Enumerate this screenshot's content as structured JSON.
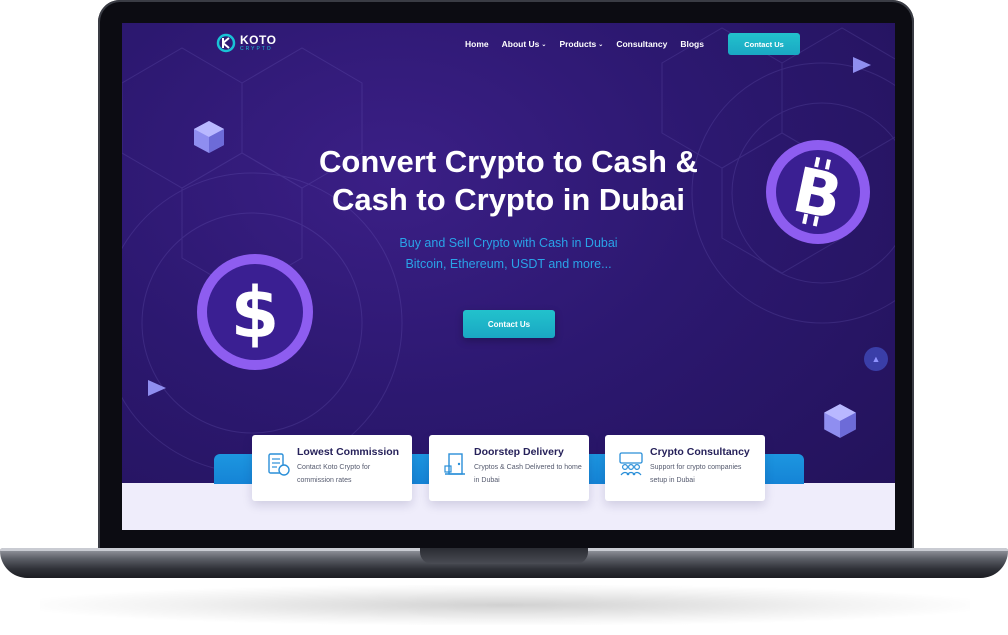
{
  "header": {
    "logo": {
      "name": "KOTO",
      "sub": "CRYPTO"
    },
    "nav": [
      {
        "label": "Home",
        "dropdown": false
      },
      {
        "label": "About Us",
        "dropdown": true
      },
      {
        "label": "Products",
        "dropdown": true
      },
      {
        "label": "Consultancy",
        "dropdown": false
      },
      {
        "label": "Blogs",
        "dropdown": false
      }
    ],
    "contact_button": "Contact Us"
  },
  "hero": {
    "title_line1": "Convert Crypto to Cash &",
    "title_line2": "Cash to Crypto in Dubai",
    "subtitle_line1": "Buy and Sell Crypto with Cash in Dubai",
    "subtitle_line2": "Bitcoin, Ethereum, USDT and more...",
    "contact_button": "Contact Us"
  },
  "features": [
    {
      "title": "Lowest Commission",
      "desc": "Contact Koto Crypto for commission rates",
      "icon": "document-icon"
    },
    {
      "title": "Doorstep Delivery",
      "desc": "Cryptos & Cash Delivered to home in Dubai",
      "icon": "door-icon"
    },
    {
      "title": "Crypto Consultancy",
      "desc": "Support for crypto companies setup in Dubai",
      "icon": "team-icon"
    }
  ],
  "colors": {
    "hero_bg": "#2c1870",
    "accent_teal": "#1aa7c4",
    "accent_blue": "#2aa3e8",
    "coin_purple": "#7b4fe0",
    "card_title": "#26215a"
  },
  "decorations": [
    "bitcoin-coin-icon",
    "dollar-coin-icon",
    "cube-icon",
    "triangle-icon",
    "scroll-to-top-icon"
  ]
}
